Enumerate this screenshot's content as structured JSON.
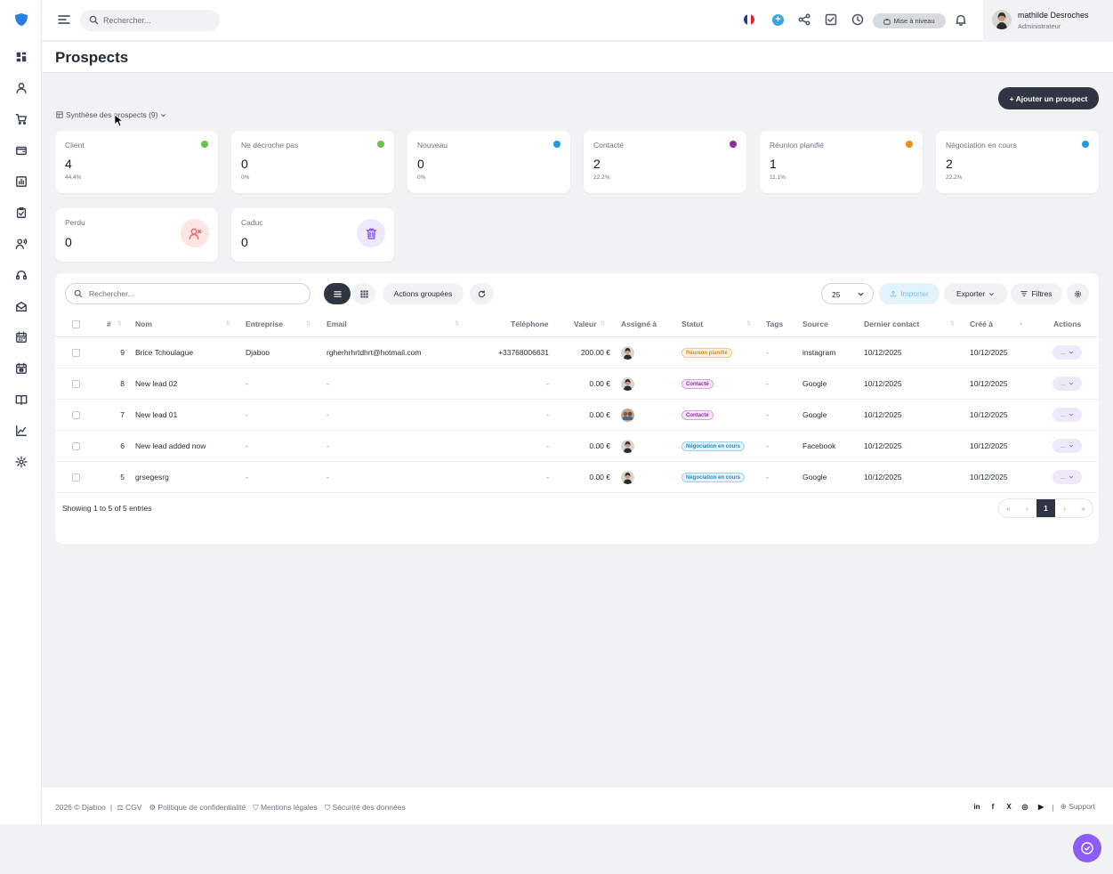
{
  "topbar": {
    "search_placeholder": "Rechercher...",
    "upgrade_label": "Mise à niveau",
    "user_name": "mathilde Desroches",
    "user_role": "Administrateur"
  },
  "page": {
    "title": "Prospects",
    "add_button": "+ Ajouter un prospect",
    "summary_toggle": "Synthèse des prospects (9)"
  },
  "stats": [
    {
      "label": "Client",
      "value": "4",
      "percent": "44.4%",
      "color": "#6cc24a"
    },
    {
      "label": "Ne décroche pas",
      "value": "0",
      "percent": "0%",
      "color": "#6cc24a"
    },
    {
      "label": "Nouveau",
      "value": "0",
      "percent": "0%",
      "color": "#1e9be0"
    },
    {
      "label": "Contacté",
      "value": "2",
      "percent": "22.2%",
      "color": "#8e2e9f"
    },
    {
      "label": "Réunion planifié",
      "value": "1",
      "percent": "11.1%",
      "color": "#f28c1a"
    },
    {
      "label": "Négociation en cours",
      "value": "2",
      "percent": "22.2%",
      "color": "#1e9be0"
    }
  ],
  "stats_extra": [
    {
      "label": "Perdu",
      "value": "0",
      "icon": "user-x-icon",
      "icon_color": "#e86a6a",
      "bg": "#fde5e5"
    },
    {
      "label": "Caduc",
      "value": "0",
      "icon": "trash-icon",
      "icon_color": "#8b5cf6",
      "bg": "#eee8fb"
    }
  ],
  "toolbar": {
    "search_placeholder": "Rechercher...",
    "bulk_actions": "Actions groupées",
    "per_page": "25",
    "import": "Importer",
    "export": "Exporter",
    "filters": "Filtres"
  },
  "columns": [
    "#",
    "Nom",
    "Entreprise",
    "Email",
    "Téléphone",
    "Valeur",
    "Assigné à",
    "Statut",
    "Tags",
    "Source",
    "Dernier contact",
    "Créé à",
    "Actions"
  ],
  "rows": [
    {
      "id": "9",
      "name": "Brice Tchoulague",
      "company": "Djaboo",
      "email": "rgherhrhrtdhrt@hotmail.com",
      "phone": "+33768006631",
      "value": "200.00 €",
      "status": "Réunion planifié",
      "status_kind": "reunion",
      "tags": "-",
      "source": "instagram",
      "last_contact": "10/12/2025",
      "created": "10/12/2025",
      "action": "..."
    },
    {
      "id": "8",
      "name": "New lead 02",
      "company": "-",
      "email": "-",
      "phone": "-",
      "value": "0.00 €",
      "status": "Contacté",
      "status_kind": "contacte",
      "tags": "-",
      "source": "Google",
      "last_contact": "10/12/2025",
      "created": "10/12/2025",
      "action": "..."
    },
    {
      "id": "7",
      "name": "New lead 01",
      "company": "-",
      "email": "-",
      "phone": "-",
      "value": "0.00 €",
      "status": "Contacté",
      "status_kind": "contacte",
      "tags": "-",
      "source": "Google",
      "last_contact": "10/12/2025",
      "created": "10/12/2025",
      "action": "..."
    },
    {
      "id": "6",
      "name": "New lead added now",
      "company": "-",
      "email": "-",
      "phone": "-",
      "value": "0.00 €",
      "status": "Négociation en cours",
      "status_kind": "nego",
      "tags": "-",
      "source": "Facebook",
      "last_contact": "10/12/2025",
      "created": "10/12/2025",
      "action": "..."
    },
    {
      "id": "5",
      "name": "grsegesrg",
      "company": "-",
      "email": "-",
      "phone": "-",
      "value": "0.00 €",
      "status": "Négociation en cours",
      "status_kind": "nego",
      "tags": "-",
      "source": "Google",
      "last_contact": "10/12/2025",
      "created": "10/12/2025",
      "action": "..."
    }
  ],
  "pagination": {
    "showing": "Showing 1 to 5 of 5 entries",
    "first": "«",
    "prev": "‹",
    "current": "1",
    "next": "›",
    "last": "»"
  },
  "footer": {
    "copyright": "2026 © Djaboo",
    "links": [
      "CGV",
      "Politique de confidentialité",
      "Mentions légales",
      "Sécurité des données"
    ],
    "social": [
      "in",
      "f",
      "X",
      "◎",
      "▶"
    ],
    "support": "Support"
  }
}
